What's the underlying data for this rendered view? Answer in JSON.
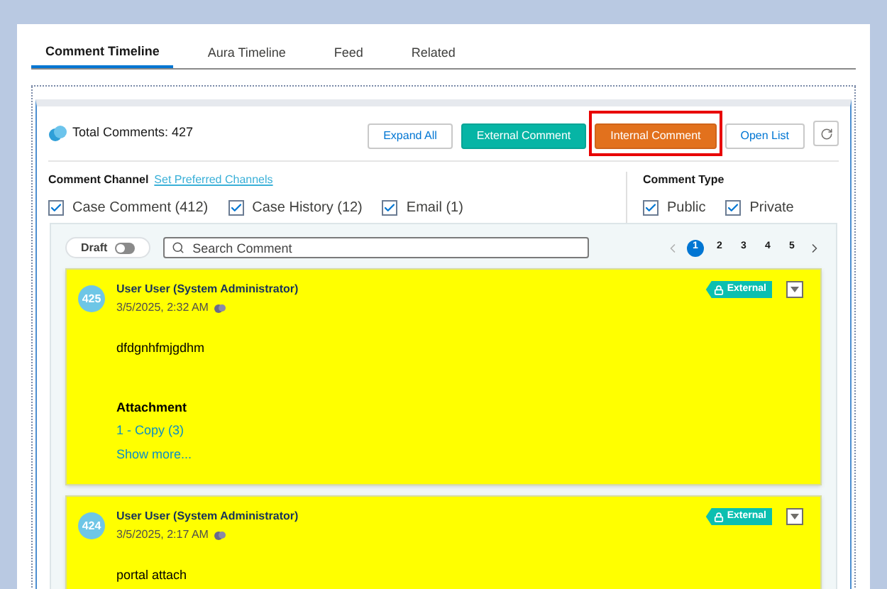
{
  "tabs": [
    {
      "label": "Comment Timeline",
      "selected": true
    },
    {
      "label": "Aura Timeline",
      "selected": false
    },
    {
      "label": "Feed",
      "selected": false
    },
    {
      "label": "Related",
      "selected": false
    }
  ],
  "summary": {
    "label": "Total Comments:",
    "count": "427"
  },
  "actions": [
    {
      "label": "Expand All",
      "kind": "outline",
      "highlighted": false
    },
    {
      "label": "External Comment",
      "kind": "teal",
      "highlighted": false
    },
    {
      "label": "Internal Comment",
      "kind": "orange",
      "highlighted": true
    },
    {
      "label": "Open List",
      "kind": "outline",
      "highlighted": false
    }
  ],
  "channels": {
    "title": "Comment Channel",
    "link": "Set Preferred Channels",
    "options": [
      {
        "label": "Case Comment (412)",
        "checked": true
      },
      {
        "label": "Case History (12)",
        "checked": true
      },
      {
        "label": "Email (1)",
        "checked": true
      }
    ]
  },
  "comment_type": {
    "title": "Comment Type",
    "options": [
      {
        "label": "Public",
        "checked": true
      },
      {
        "label": "Private",
        "checked": true
      }
    ]
  },
  "draft": {
    "label": "Draft",
    "on": false
  },
  "search": {
    "placeholder": "Search Comment"
  },
  "pagination": {
    "pages": [
      {
        "label": "1",
        "selected": true
      },
      {
        "label": "2",
        "selected": false
      },
      {
        "label": "3",
        "selected": false
      },
      {
        "label": "4",
        "selected": false
      },
      {
        "label": "5",
        "selected": false
      }
    ]
  },
  "comments": [
    {
      "number": "425",
      "author": "User User (System Administrator)",
      "timestamp": "3/5/2025, 2:32 AM",
      "visibility": "External",
      "body": "dfdgnhfmjgdhm",
      "attachment": {
        "title": "Attachment",
        "files": [
          "1 - Copy (3)"
        ],
        "more": "Show more..."
      }
    },
    {
      "number": "424",
      "author": "User User (System Administrator)",
      "timestamp": "3/5/2025, 2:17 AM",
      "visibility": "External",
      "body": "portal attach"
    }
  ]
}
